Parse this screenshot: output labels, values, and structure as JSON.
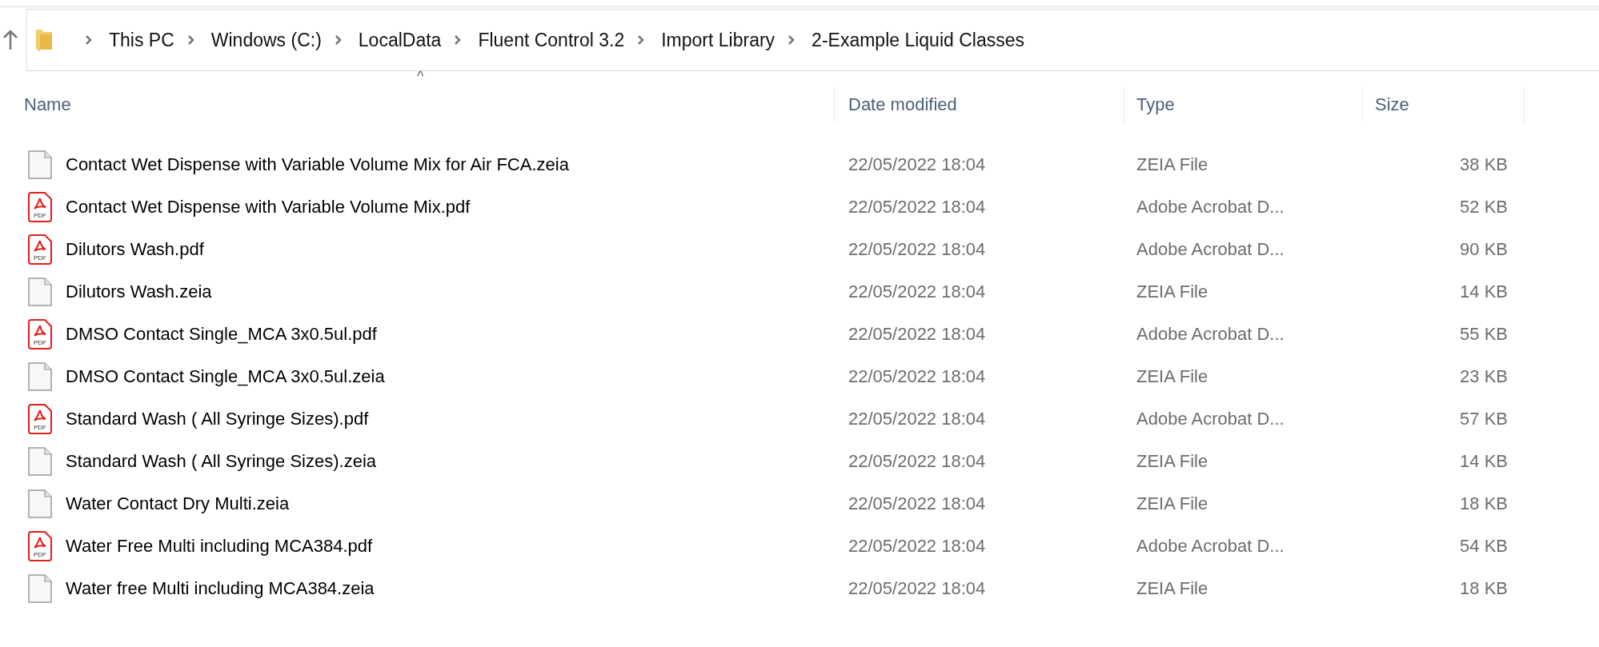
{
  "breadcrumb": [
    "This PC",
    "Windows (C:)",
    "LocalData",
    "Fluent Control 3.2",
    "Import Library",
    "2-Example Liquid Classes"
  ],
  "sort_indicator": "^",
  "columns": [
    "Name",
    "Date modified",
    "Type",
    "Size"
  ],
  "files": [
    {
      "kind": "blank",
      "name": "Contact Wet Dispense with Variable Volume Mix for Air FCA.zeia",
      "date": "22/05/2022 18:04",
      "type": "ZEIA File",
      "size": "38 KB"
    },
    {
      "kind": "pdf",
      "icon_text": "PDF",
      "name": "Contact Wet Dispense with Variable Volume Mix.pdf",
      "date": "22/05/2022 18:04",
      "type": "Adobe Acrobat D...",
      "size": "52 KB"
    },
    {
      "kind": "pdf",
      "icon_text": "PDF",
      "name": "Dilutors Wash.pdf",
      "date": "22/05/2022 18:04",
      "type": "Adobe Acrobat D...",
      "size": "90 KB"
    },
    {
      "kind": "blank",
      "name": "Dilutors Wash.zeia",
      "date": "22/05/2022 18:04",
      "type": "ZEIA File",
      "size": "14 KB"
    },
    {
      "kind": "pdf",
      "icon_text": "PDF",
      "name": "DMSO Contact Single_MCA 3x0.5ul.pdf",
      "date": "22/05/2022 18:04",
      "type": "Adobe Acrobat D...",
      "size": "55 KB"
    },
    {
      "kind": "blank",
      "name": "DMSO Contact Single_MCA 3x0.5ul.zeia",
      "date": "22/05/2022 18:04",
      "type": "ZEIA File",
      "size": "23 KB"
    },
    {
      "kind": "pdf",
      "icon_text": "PDF",
      "name": "Standard Wash ( All Syringe Sizes).pdf",
      "date": "22/05/2022 18:04",
      "type": "Adobe Acrobat D...",
      "size": "57 KB"
    },
    {
      "kind": "blank",
      "name": "Standard Wash ( All Syringe Sizes).zeia",
      "date": "22/05/2022 18:04",
      "type": "ZEIA File",
      "size": "14 KB"
    },
    {
      "kind": "blank",
      "name": "Water Contact Dry Multi.zeia",
      "date": "22/05/2022 18:04",
      "type": "ZEIA File",
      "size": "18 KB"
    },
    {
      "kind": "pdf",
      "icon_text": "PDF",
      "name": "Water Free Multi including MCA384.pdf",
      "date": "22/05/2022 18:04",
      "type": "Adobe Acrobat D...",
      "size": "54 KB"
    },
    {
      "kind": "blank",
      "name": "Water free Multi including MCA384.zeia",
      "date": "22/05/2022 18:04",
      "type": "ZEIA File",
      "size": "18 KB"
    }
  ]
}
